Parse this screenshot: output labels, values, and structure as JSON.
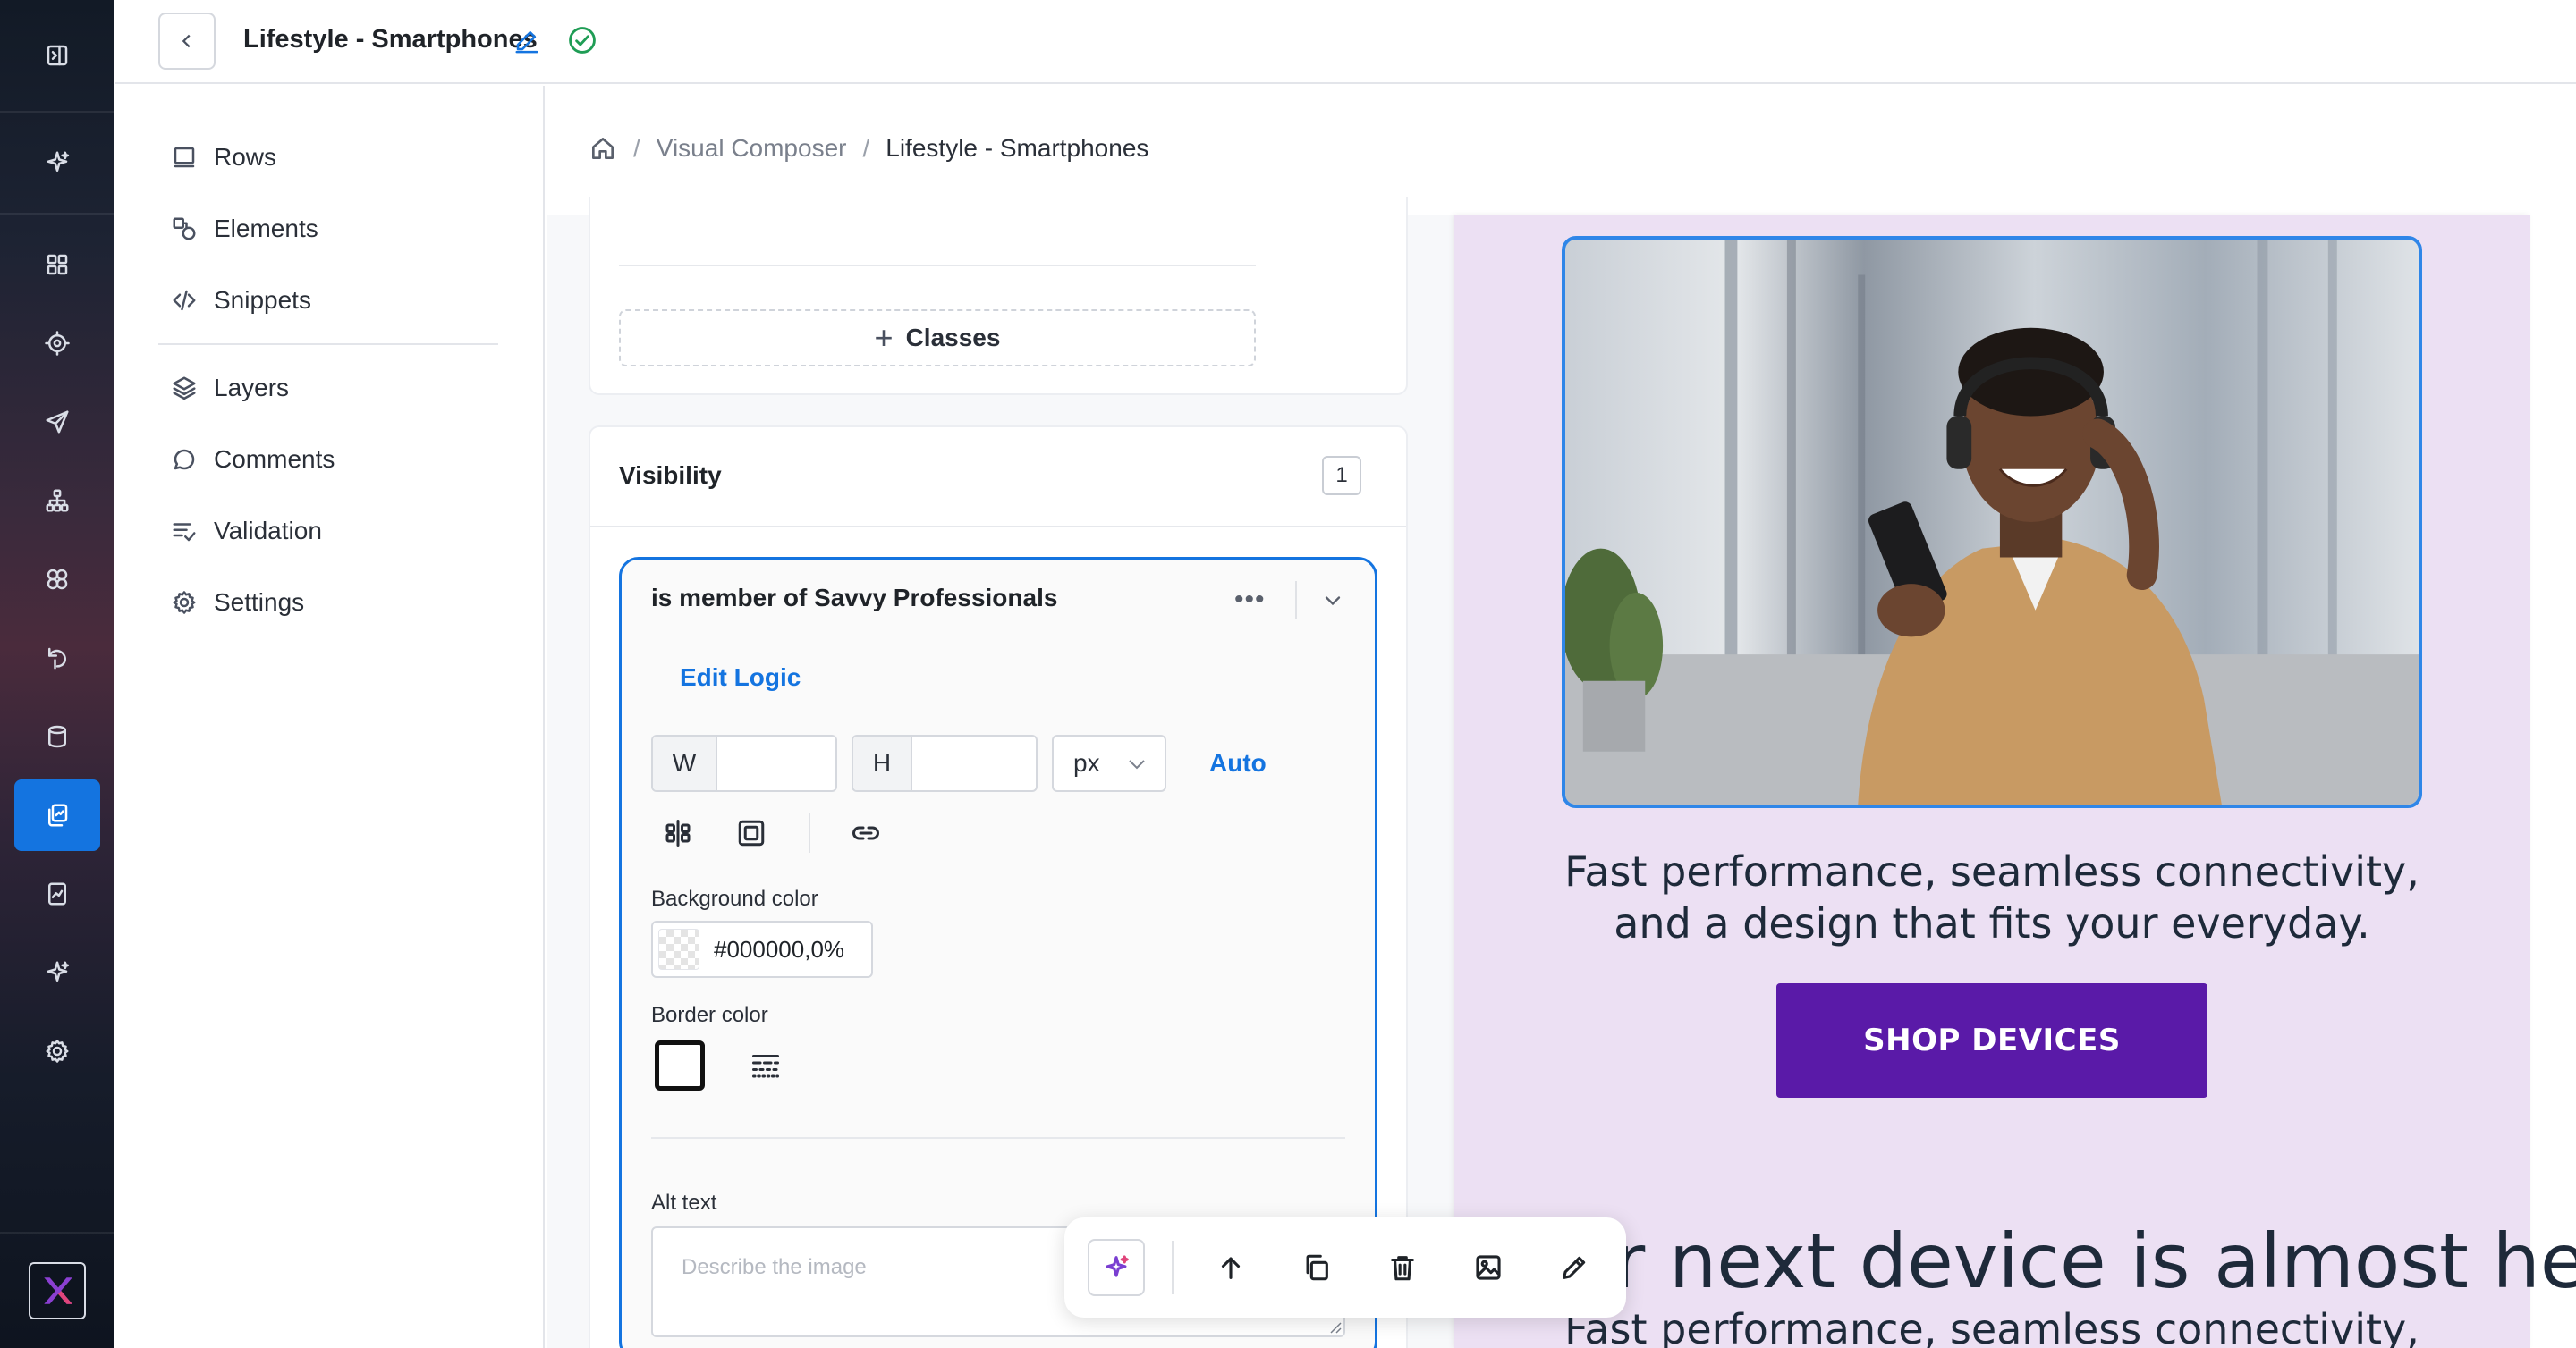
{
  "header": {
    "title": "Lifestyle - Smartphones"
  },
  "breadcrumb": {
    "items": [
      "Visual Composer",
      "Lifestyle - Smartphones"
    ]
  },
  "sidenav": {
    "items": [
      {
        "label": "Rows",
        "icon": "rows-icon"
      },
      {
        "label": "Elements",
        "icon": "elements-icon"
      },
      {
        "label": "Snippets",
        "icon": "code-icon"
      },
      {
        "label": "Layers",
        "icon": "layers-icon"
      },
      {
        "label": "Comments",
        "icon": "comment-icon"
      },
      {
        "label": "Validation",
        "icon": "validation-icon"
      },
      {
        "label": "Settings",
        "icon": "gear-icon"
      }
    ]
  },
  "panel": {
    "classes_label": "Classes",
    "visibility": {
      "title": "Visibility",
      "count": "1"
    },
    "rule": {
      "title": "is member of Savvy Professionals",
      "more": "•••",
      "edit_logic": "Edit Logic",
      "width_label": "W",
      "width_value": "",
      "height_label": "H",
      "height_value": "",
      "unit": "px",
      "auto_label": "Auto",
      "bg_color_label": "Background color",
      "bg_color_value": "#000000,0%",
      "border_color_label": "Border color",
      "alt_text_label": "Alt text",
      "alt_text_placeholder": "Describe the image"
    }
  },
  "canvas": {
    "body_text": "Fast performance, seamless connectivity,",
    "body_text_2": "and a design that fits your everyday.",
    "cta_label": "SHOP DEVICES",
    "headline": "Your next device is almost here",
    "body_text_bottom": "Fast performance, seamless connectivity,",
    "colors": {
      "background": "#ece0f3",
      "cta": "#5a1aa8",
      "selection": "#1474e0"
    }
  },
  "rail": {
    "icons": [
      "collapse-icon",
      "sparkle-icon",
      "grid-icon",
      "target-icon",
      "send-icon",
      "hierarchy-icon",
      "components-icon",
      "recycle-icon",
      "database-icon",
      "pages-icon",
      "reports-icon",
      "sparkle-icon",
      "gear-icon"
    ],
    "active": "pages-icon"
  },
  "toolbar": {
    "buttons": [
      "ai-sparkle-icon",
      "move-up-icon",
      "duplicate-icon",
      "delete-icon",
      "image-icon",
      "edit-icon"
    ]
  }
}
